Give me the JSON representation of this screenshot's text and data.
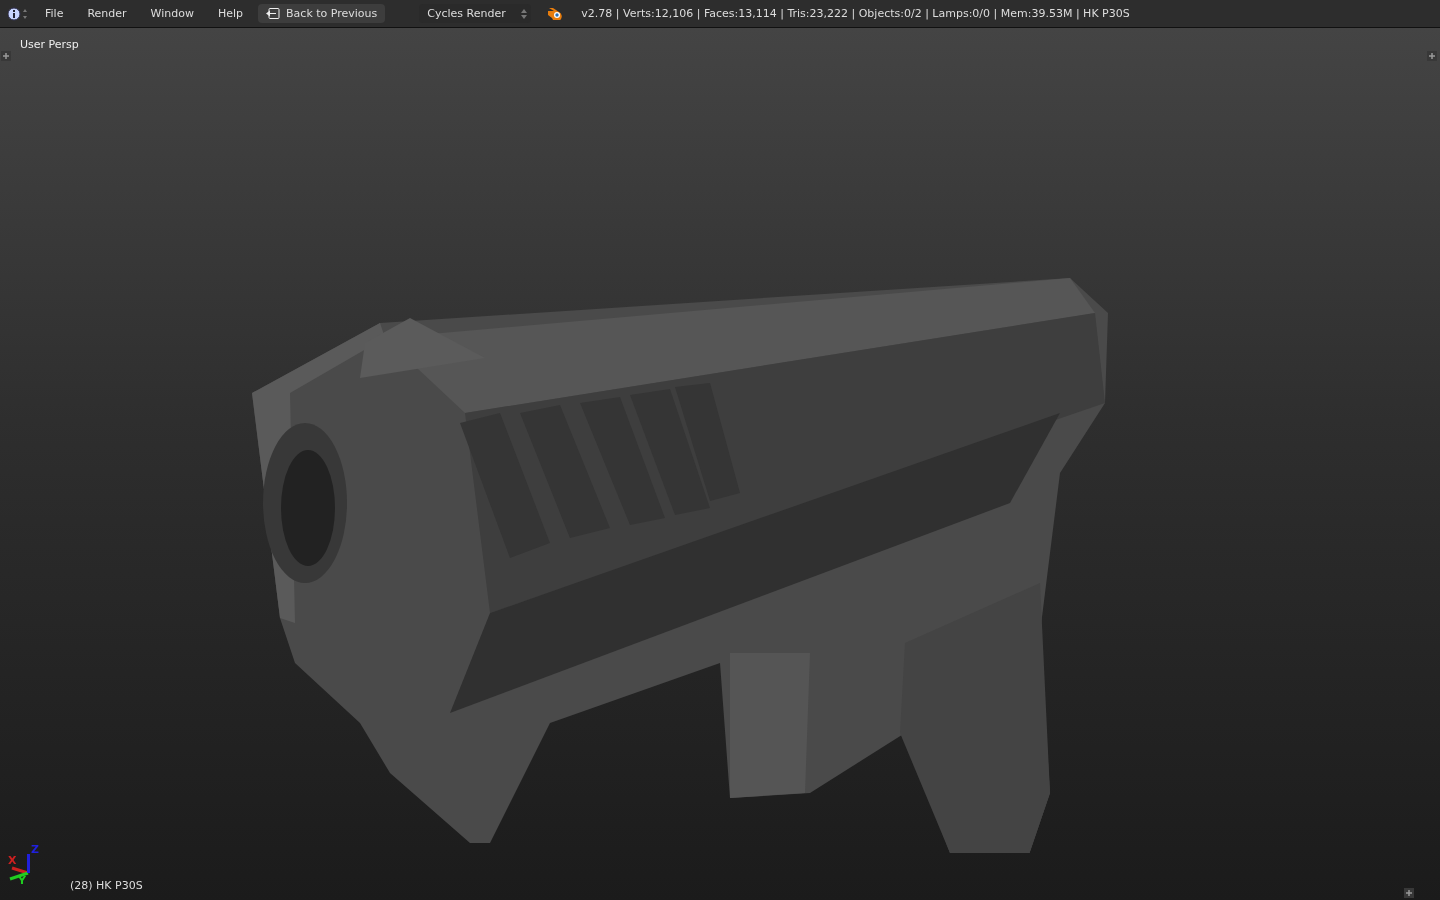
{
  "header": {
    "menus": [
      "File",
      "Render",
      "Window",
      "Help"
    ],
    "back_button": "Back to Previous",
    "render_engine": "Cycles Render",
    "stats": "v2.78 | Verts:12,106 | Faces:13,114 | Tris:23,222 | Objects:0/2 | Lamps:0/0 | Mem:39.53M | HK P30S"
  },
  "viewport": {
    "view_name": "User Persp",
    "object_label": "(28) HK P30S",
    "axes": [
      {
        "label": "X",
        "color": "#cc2020"
      },
      {
        "label": "Y",
        "color": "#20cc20"
      },
      {
        "label": "Z",
        "color": "#2020dd"
      }
    ]
  }
}
